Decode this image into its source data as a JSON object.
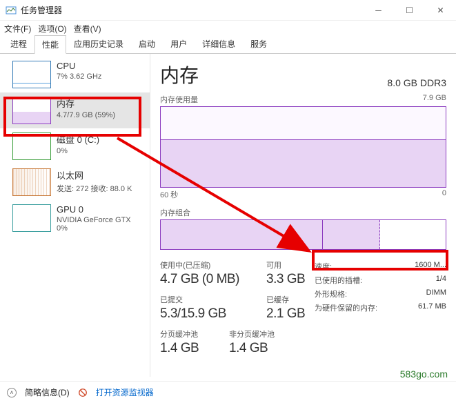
{
  "window": {
    "title": "任务管理器"
  },
  "menu": {
    "file": "文件(F)",
    "options": "选项(O)",
    "view": "查看(V)"
  },
  "tabs": [
    "进程",
    "性能",
    "应用历史记录",
    "启动",
    "用户",
    "详细信息",
    "服务"
  ],
  "sidebar": [
    {
      "name": "CPU",
      "detail": "7% 3.62 GHz"
    },
    {
      "name": "内存",
      "detail": "4.7/7.9 GB (59%)"
    },
    {
      "name": "磁盘 0 (C:)",
      "detail": "0%"
    },
    {
      "name": "以太网",
      "detail": "发送: 272  接收: 88.0 K"
    },
    {
      "name": "GPU 0",
      "detail": "NVIDIA GeForce GTX  0%"
    }
  ],
  "header": {
    "title": "内存",
    "spec": "8.0 GB DDR3"
  },
  "graph": {
    "usage_label": "内存使用量",
    "usage_max": "7.9 GB",
    "time_label": "60 秒",
    "time_end": "0",
    "compose_label": "内存组合"
  },
  "stats": {
    "used_label": "使用中(已压缩)",
    "used_val": "4.7 GB (0 MB)",
    "avail_label": "可用",
    "avail_val": "3.3 GB",
    "commit_label": "已提交",
    "commit_val": "5.3/15.9 GB",
    "cached_label": "已缓存",
    "cached_val": "2.1 GB",
    "paged_label": "分页缓冲池",
    "paged_val": "1.4 GB",
    "nonpaged_label": "非分页缓冲池",
    "nonpaged_val": "1.4 GB"
  },
  "right": {
    "speed_k": "速度:",
    "speed_v": "1600 M...",
    "slots_k": "已使用的插槽:",
    "slots_v": "1/4",
    "form_k": "外形规格:",
    "form_v": "DIMM",
    "hw_k": "为硬件保留的内存:",
    "hw_v": "61.7 MB"
  },
  "bottom": {
    "less": "简略信息(D)",
    "resmon": "打开资源监视器"
  },
  "watermark": "583go.com"
}
